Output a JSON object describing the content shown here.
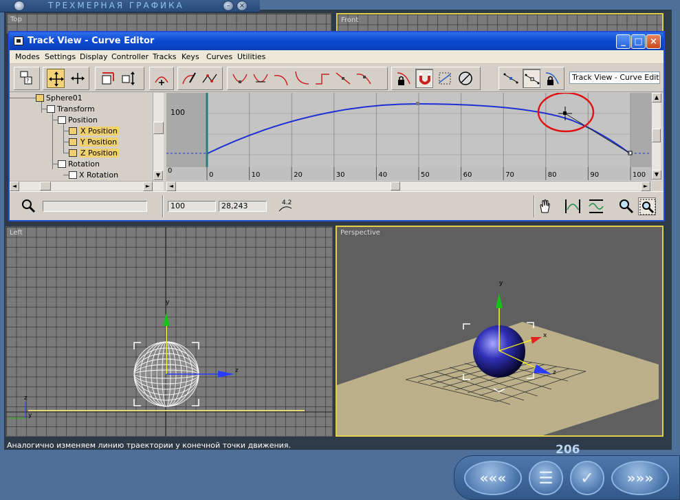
{
  "app": {
    "title": "ТРЕХМЕРНАЯ ГРАФИКА",
    "minimize_glyph": "–",
    "close_glyph": "×"
  },
  "viewports": {
    "top_label": "Top",
    "front_label": "Front",
    "left_label": "Left",
    "perspective_label": "Perspective"
  },
  "axes": {
    "x": "x",
    "y": "y",
    "z": "z"
  },
  "track_view": {
    "title": "Track View - Curve Editor",
    "window_buttons": {
      "minimize": "_",
      "maximize": "□",
      "close": "×"
    },
    "menu": [
      "Modes",
      "Settings",
      "Display",
      "Controller",
      "Tracks",
      "Keys",
      "Curves",
      "Utilities"
    ],
    "name_field": "Track View - Curve Editor",
    "hierarchy": [
      {
        "label": "Sphere01",
        "level": 0,
        "highlight": false,
        "icon": "sphere-object-icon"
      },
      {
        "label": "Transform",
        "level": 1,
        "highlight": false,
        "icon": "transform-icon"
      },
      {
        "label": "Position",
        "level": 2,
        "highlight": false,
        "icon": "position-icon"
      },
      {
        "label": "X Position",
        "level": 3,
        "highlight": true,
        "icon": "curve-track-icon"
      },
      {
        "label": "Y Position",
        "level": 3,
        "highlight": true,
        "icon": "curve-track-icon"
      },
      {
        "label": "Z Position",
        "level": 3,
        "highlight": true,
        "icon": "curve-track-icon"
      },
      {
        "label": "Rotation",
        "level": 2,
        "highlight": false,
        "icon": "rotation-icon"
      },
      {
        "label": "X Rotation",
        "level": 3,
        "highlight": false,
        "icon": "curve-track-icon"
      }
    ],
    "graph": {
      "value_label": "100",
      "zero_label": "0",
      "frame_ticks": [
        "0",
        "10",
        "20",
        "30",
        "40",
        "50",
        "60",
        "70",
        "80",
        "90",
        "100"
      ]
    },
    "status": {
      "frame_value": "100",
      "value_value": "28,243",
      "snap_value": "4.2"
    }
  },
  "caption": "Аналогично изменяем линию траектории у конечной точки движения.",
  "page_number": "206",
  "nav": {
    "prev": "«««",
    "menu": "☰",
    "check": "✓",
    "next": "»»»"
  }
}
